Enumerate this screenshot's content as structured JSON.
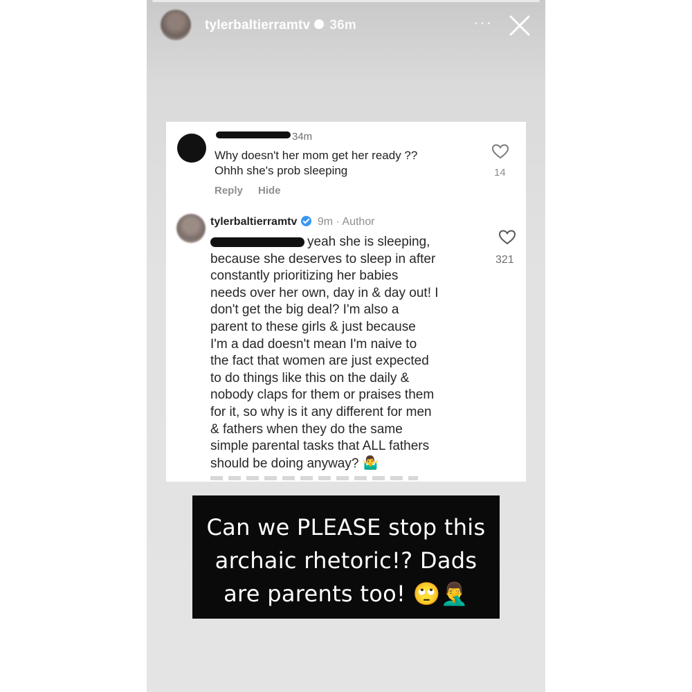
{
  "story": {
    "username": "tylerbaltierramtv",
    "time": "36m",
    "more_label": "···",
    "icons": {
      "verified": "verified-badge-icon",
      "more": "more-options-icon",
      "close": "close-icon"
    }
  },
  "comment_card": {
    "comments": [
      {
        "time": "34m",
        "lines": [
          "Why doesn't her mom get her ready ??",
          "Ohhh she's prob sleeping"
        ],
        "actions": {
          "reply": "Reply",
          "hide": "Hide"
        },
        "likes": "14"
      },
      {
        "username": "tylerbaltierramtv",
        "meta": "9m · Author",
        "lines": [
          "yeah she is sleeping,",
          "because she deserves to sleep in after",
          "constantly prioritizing her babies",
          "needs over her own, day in & day out! I",
          "don't get the big deal? I'm also a",
          "parent to these girls & just because",
          "I'm a dad doesn't mean I'm naive to",
          "the fact that women are just expected",
          "to do things like this on the daily &",
          "nobody claps for them or praises them",
          "for it, so why is it any different for men",
          "& fathers when they do the same",
          "simple parental tasks that ALL fathers",
          "should be doing anyway?"
        ],
        "emoji": "🤷‍♂️",
        "likes": "321"
      }
    ]
  },
  "caption": {
    "lines": [
      "Can we PLEASE stop this",
      "archaic rhetoric!? Dads",
      "are parents too! 🙄🤦‍♂️"
    ]
  }
}
